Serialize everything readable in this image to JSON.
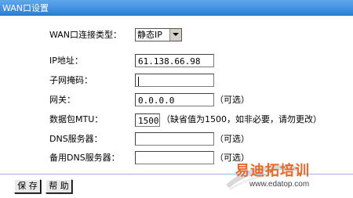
{
  "window": {
    "title": "WAN口设置"
  },
  "form": {
    "connection_type_label": "WAN口连接类型：",
    "connection_type_value": "静态IP",
    "ip_label": "IP地址：",
    "ip_value": "61.138.66.98",
    "mask_label": "子网掩码：",
    "mask_value": "",
    "gateway_label": "网关：",
    "gateway_value": "0.0.0.0",
    "gateway_hint": "（可选）",
    "mtu_label": "数据包MTU：",
    "mtu_value": "1500",
    "mtu_hint": "（缺省值为1500，如非必要，请勿更改）",
    "dns_label": "DNS服务器：",
    "dns_value": "",
    "dns_hint": "（可选）",
    "dns2_label": "备用DNS服务器：",
    "dns2_value": "",
    "dns2_hint": "（可选）"
  },
  "buttons": {
    "save": "保 存",
    "help": "帮 助"
  },
  "watermark": {
    "text": "易迪拓培训",
    "url": "www.edatop.com"
  }
}
